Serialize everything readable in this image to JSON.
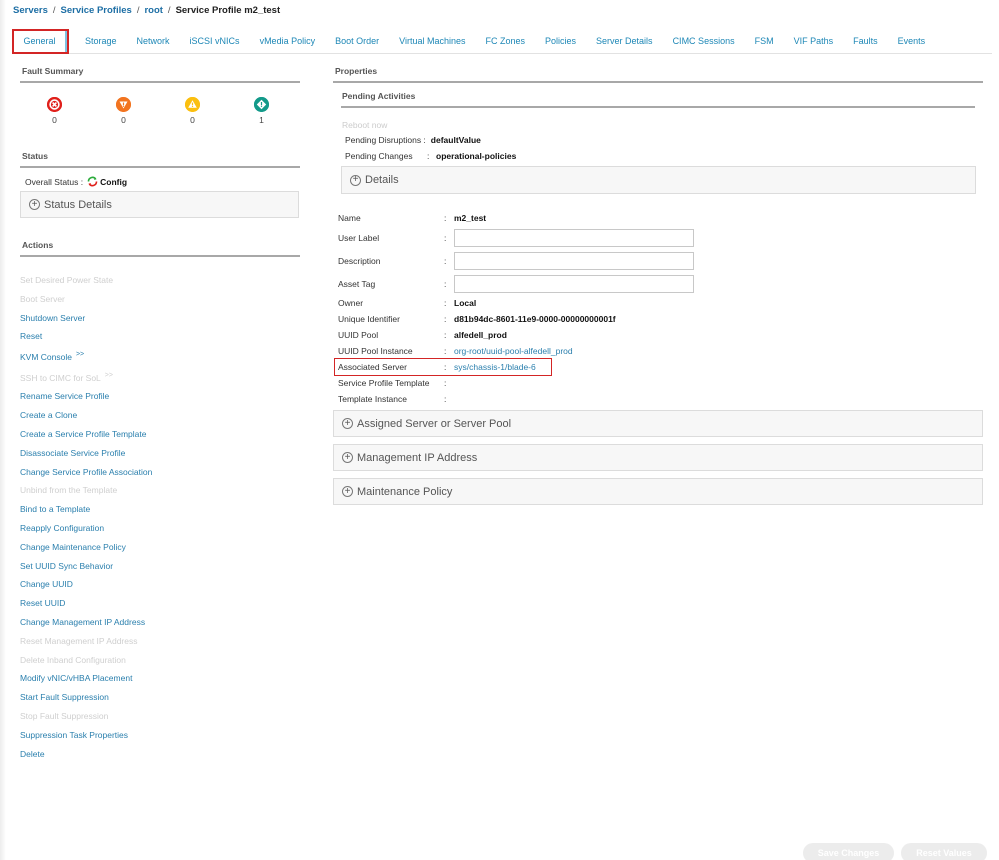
{
  "breadcrumb": {
    "items": [
      "Servers",
      "Service Profiles",
      "root"
    ],
    "current": "Service Profile m2_test",
    "separator": "/"
  },
  "tabs": [
    {
      "label": "General",
      "active": true
    },
    {
      "label": "Storage"
    },
    {
      "label": "Network"
    },
    {
      "label": "iSCSI vNICs"
    },
    {
      "label": "vMedia Policy"
    },
    {
      "label": "Boot Order"
    },
    {
      "label": "Virtual Machines"
    },
    {
      "label": "FC Zones"
    },
    {
      "label": "Policies"
    },
    {
      "label": "Server Details"
    },
    {
      "label": "CIMC Sessions"
    },
    {
      "label": "FSM"
    },
    {
      "label": "VIF Paths"
    },
    {
      "label": "Faults"
    },
    {
      "label": "Events"
    }
  ],
  "fault_summary": {
    "title": "Fault Summary",
    "items": [
      {
        "severity": "critical",
        "icon": "x-circle-icon",
        "count": "0",
        "color": "#e0201b"
      },
      {
        "severity": "major",
        "icon": "down-triangle-exclamation-icon",
        "count": "0",
        "color": "#f27420"
      },
      {
        "severity": "minor",
        "icon": "warning-triangle-icon",
        "count": "0",
        "color": "#fbbf0f"
      },
      {
        "severity": "warning",
        "icon": "diamond-exclamation-icon",
        "count": "1",
        "color": "#139a8a"
      }
    ]
  },
  "status": {
    "title": "Status",
    "overall_label": "Overall Status :",
    "overall_value": "Config",
    "details_label": "Status Details"
  },
  "actions": {
    "title": "Actions",
    "items": [
      {
        "label": "Set Desired Power State",
        "enabled": false
      },
      {
        "label": "Boot Server",
        "enabled": false
      },
      {
        "label": "Shutdown Server",
        "enabled": true
      },
      {
        "label": "Reset",
        "enabled": true
      },
      {
        "label": "KVM Console",
        "enabled": true,
        "suffix": ">>"
      },
      {
        "label": "SSH to CIMC for SoL",
        "enabled": false,
        "suffix": ">>"
      },
      {
        "label": "Rename Service Profile",
        "enabled": true
      },
      {
        "label": "Create a Clone",
        "enabled": true
      },
      {
        "label": "Create a Service Profile Template",
        "enabled": true
      },
      {
        "label": "Disassociate Service Profile",
        "enabled": true
      },
      {
        "label": "Change Service Profile Association",
        "enabled": true
      },
      {
        "label": "Unbind from the Template",
        "enabled": false
      },
      {
        "label": "Bind to a Template",
        "enabled": true
      },
      {
        "label": "Reapply Configuration",
        "enabled": true
      },
      {
        "label": "Change Maintenance Policy",
        "enabled": true
      },
      {
        "label": "Set UUID Sync Behavior",
        "enabled": true
      },
      {
        "label": "Change UUID",
        "enabled": true
      },
      {
        "label": "Reset UUID",
        "enabled": true
      },
      {
        "label": "Change Management IP Address",
        "enabled": true
      },
      {
        "label": "Reset Management IP Address",
        "enabled": false
      },
      {
        "label": "Delete Inband Configuration",
        "enabled": false
      },
      {
        "label": "Modify vNIC/vHBA Placement",
        "enabled": true
      },
      {
        "label": "Start Fault Suppression",
        "enabled": true
      },
      {
        "label": "Stop Fault Suppression",
        "enabled": false
      },
      {
        "label": "Suppression Task Properties",
        "enabled": true
      },
      {
        "label": "Delete",
        "enabled": true
      }
    ]
  },
  "properties": {
    "title": "Properties",
    "pending": {
      "title": "Pending Activities",
      "reboot_label": "Reboot now",
      "disruptions_label": "Pending Disruptions :",
      "disruptions_value": "defaultValue",
      "changes_label": "Pending Changes",
      "changes_colon": ":",
      "changes_value": "operational-policies",
      "details_label": "Details"
    },
    "fields": {
      "name": {
        "label": "Name",
        "value": "m2_test"
      },
      "user_label": {
        "label": "User Label",
        "value": ""
      },
      "description": {
        "label": "Description",
        "value": ""
      },
      "asset_tag": {
        "label": "Asset Tag",
        "value": ""
      },
      "owner": {
        "label": "Owner",
        "value": "Local"
      },
      "uuid": {
        "label": "Unique Identifier",
        "value": "d81b94dc-8601-11e9-0000-00000000001f"
      },
      "uuid_pool": {
        "label": "UUID Pool",
        "value": "alfedell_prod"
      },
      "uuid_pool_instance": {
        "label": "UUID Pool Instance",
        "value": "org-root/uuid-pool-alfedell_prod"
      },
      "associated_server": {
        "label": "Associated Server",
        "value": "sys/chassis-1/blade-6"
      },
      "sp_template": {
        "label": "Service Profile Template",
        "value": ""
      },
      "template_instance": {
        "label": "Template Instance",
        "value": ""
      }
    },
    "colon": ":",
    "sections": [
      {
        "label": "Assigned Server or Server Pool"
      },
      {
        "label": "Management IP Address"
      },
      {
        "label": "Maintenance Policy"
      }
    ]
  },
  "footer": {
    "save_label": "Save Changes",
    "reset_label": "Reset Values"
  },
  "colors": {
    "link": "#2a7fad",
    "tab": "#1d87b6",
    "highlight": "#d32525",
    "disabled": "#cfcfcf"
  }
}
